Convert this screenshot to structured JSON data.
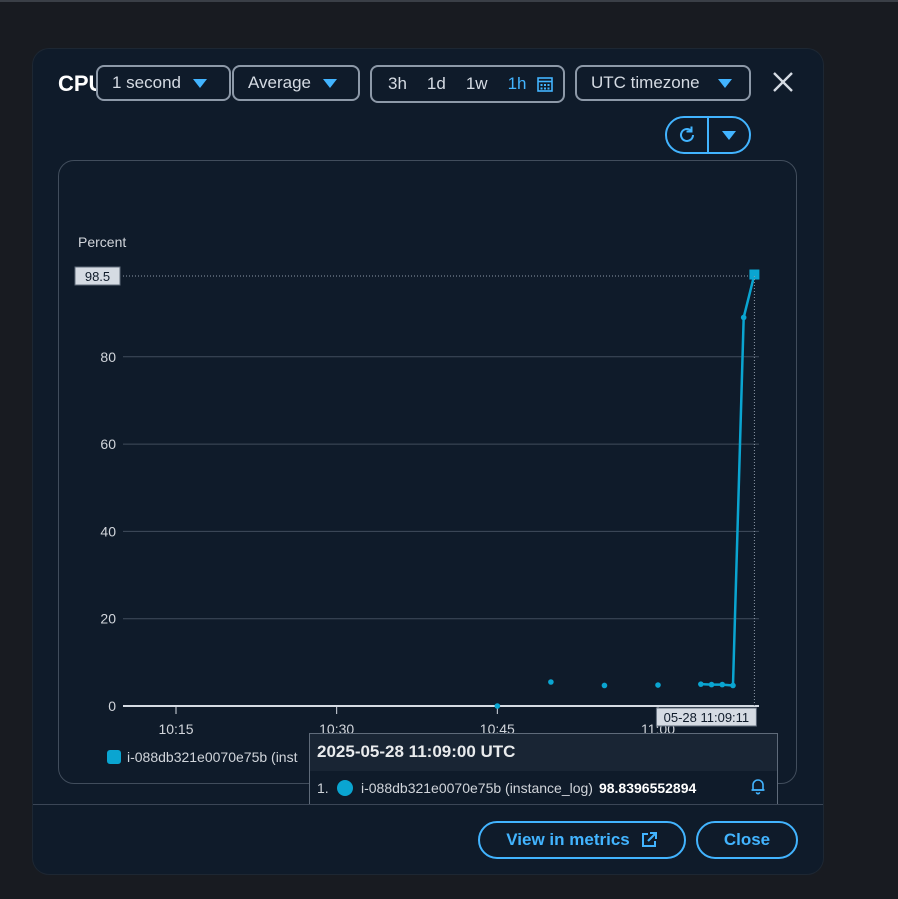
{
  "window": {
    "title": "CPU"
  },
  "toolbar": {
    "period": "1 second",
    "statistic": "Average",
    "ranges": [
      "3h",
      "1d",
      "1w",
      "1h"
    ],
    "active_range": "1h",
    "timezone": "UTC timezone"
  },
  "legend": {
    "label": "i-088db321e0070e75b (inst"
  },
  "tooltip": {
    "header": "2025-05-28 11:09:00 UTC",
    "index": "1.",
    "series": "i-088db321e0070e75b (instance_log)",
    "value": "98.8396552894"
  },
  "buttons": {
    "view_metrics": "View in metrics",
    "close": "Close"
  },
  "colors": {
    "accent": "#42b4ff",
    "series": "#0aa5d1",
    "background": "#0f1b2a"
  },
  "chart_data": {
    "type": "line",
    "ylabel": "Percent",
    "ylim": [
      0,
      98.5
    ],
    "yticks": [
      0,
      20,
      40,
      60,
      80
    ],
    "ymax_label": "98.5",
    "xticks": [
      "10:15",
      "10:30",
      "10:45",
      "11:00"
    ],
    "crosshair_label": "05-28 11:09:11",
    "series": [
      {
        "name": "i-088db321e0070e75b (instance_log)",
        "x": [
          "10:45",
          "10:50",
          "10:55",
          "11:00",
          "11:04",
          "11:05",
          "11:06",
          "11:07",
          "11:08",
          "11:09"
        ],
        "y": [
          0,
          5.5,
          4.7,
          4.8,
          5.0,
          4.9,
          4.9,
          4.7,
          89.0,
          98.84
        ]
      }
    ],
    "segments_connected_from": "11:04",
    "grid": true
  }
}
